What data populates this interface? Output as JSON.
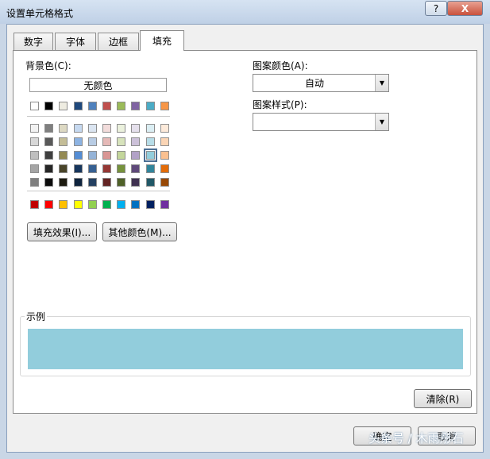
{
  "dialog": {
    "title": "设置单元格格式",
    "help": "?",
    "close": "X"
  },
  "tabs": [
    {
      "label": "数字"
    },
    {
      "label": "字体"
    },
    {
      "label": "边框"
    },
    {
      "label": "填充"
    }
  ],
  "active_tab": "填充",
  "background": {
    "label": "背景色(C):",
    "no_color": "无颜色",
    "selected": "#92cddc",
    "theme_top": [
      "#ffffff",
      "#000000",
      "#eeece1",
      "#1f497d",
      "#4f81bd",
      "#c0504d",
      "#9bbb59",
      "#8064a2",
      "#4bacc6",
      "#f79646"
    ],
    "theme_shades": [
      [
        "#f2f2f2",
        "#7f7f7f",
        "#ddd9c3",
        "#c6d9f0",
        "#dbe5f1",
        "#f2dcdb",
        "#ebf1dd",
        "#e5e0ec",
        "#dbeef3",
        "#fdeada"
      ],
      [
        "#d8d8d8",
        "#595959",
        "#c4bd97",
        "#8db3e2",
        "#b8cce4",
        "#e5b9b7",
        "#d7e3bc",
        "#ccc1d9",
        "#b7dde8",
        "#fbd5b5"
      ],
      [
        "#bfbfbf",
        "#3f3f3f",
        "#938953",
        "#548dd4",
        "#95b3d7",
        "#d99694",
        "#c3d69b",
        "#b2a2c7",
        "#92cddc",
        "#fac08f"
      ],
      [
        "#a5a5a5",
        "#262626",
        "#494429",
        "#17365d",
        "#366092",
        "#953734",
        "#76923c",
        "#5f497a",
        "#31859b",
        "#e36c09"
      ],
      [
        "#7f7f7f",
        "#0c0c0c",
        "#1d1b10",
        "#0f243e",
        "#244061",
        "#632423",
        "#4f6128",
        "#3f3151",
        "#205867",
        "#974806"
      ]
    ],
    "standard": [
      "#c00000",
      "#ff0000",
      "#ffc000",
      "#ffff00",
      "#92d050",
      "#00b050",
      "#00b0f0",
      "#0070c0",
      "#002060",
      "#7030a0"
    ],
    "fill_effects_btn": "填充效果(I)...",
    "more_colors_btn": "其他颜色(M)..."
  },
  "pattern": {
    "color_label": "图案颜色(A):",
    "color_value": "自动",
    "style_label": "图案样式(P):",
    "style_value": ""
  },
  "sample": {
    "label": "示例"
  },
  "clear_btn": "清除(R)",
  "ok_btn": "确定",
  "cancel_btn": "取消",
  "watermark": "头条号 / 木雨彤石"
}
